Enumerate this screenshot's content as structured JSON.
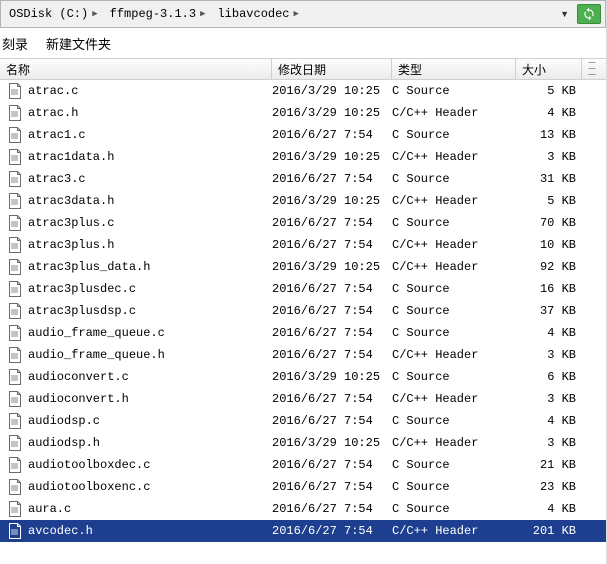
{
  "breadcrumb": {
    "root": "OSDisk (C:)",
    "p1": "ffmpeg-3.1.3",
    "p2": "libavcodec"
  },
  "toolbar": {
    "record": "刻录",
    "newfolder": "新建文件夹"
  },
  "columns": {
    "name": "名称",
    "date": "修改日期",
    "type": "类型",
    "size": "大小"
  },
  "files": [
    {
      "name": "atrac.c",
      "date": "2016/3/29 10:25",
      "type": "C Source",
      "size": "5 KB",
      "selected": false
    },
    {
      "name": "atrac.h",
      "date": "2016/3/29 10:25",
      "type": "C/C++ Header",
      "size": "4 KB",
      "selected": false
    },
    {
      "name": "atrac1.c",
      "date": "2016/6/27 7:54",
      "type": "C Source",
      "size": "13 KB",
      "selected": false
    },
    {
      "name": "atrac1data.h",
      "date": "2016/3/29 10:25",
      "type": "C/C++ Header",
      "size": "3 KB",
      "selected": false
    },
    {
      "name": "atrac3.c",
      "date": "2016/6/27 7:54",
      "type": "C Source",
      "size": "31 KB",
      "selected": false
    },
    {
      "name": "atrac3data.h",
      "date": "2016/3/29 10:25",
      "type": "C/C++ Header",
      "size": "5 KB",
      "selected": false
    },
    {
      "name": "atrac3plus.c",
      "date": "2016/6/27 7:54",
      "type": "C Source",
      "size": "70 KB",
      "selected": false
    },
    {
      "name": "atrac3plus.h",
      "date": "2016/6/27 7:54",
      "type": "C/C++ Header",
      "size": "10 KB",
      "selected": false
    },
    {
      "name": "atrac3plus_data.h",
      "date": "2016/3/29 10:25",
      "type": "C/C++ Header",
      "size": "92 KB",
      "selected": false
    },
    {
      "name": "atrac3plusdec.c",
      "date": "2016/6/27 7:54",
      "type": "C Source",
      "size": "16 KB",
      "selected": false
    },
    {
      "name": "atrac3plusdsp.c",
      "date": "2016/6/27 7:54",
      "type": "C Source",
      "size": "37 KB",
      "selected": false
    },
    {
      "name": "audio_frame_queue.c",
      "date": "2016/6/27 7:54",
      "type": "C Source",
      "size": "4 KB",
      "selected": false
    },
    {
      "name": "audio_frame_queue.h",
      "date": "2016/6/27 7:54",
      "type": "C/C++ Header",
      "size": "3 KB",
      "selected": false
    },
    {
      "name": "audioconvert.c",
      "date": "2016/3/29 10:25",
      "type": "C Source",
      "size": "6 KB",
      "selected": false
    },
    {
      "name": "audioconvert.h",
      "date": "2016/6/27 7:54",
      "type": "C/C++ Header",
      "size": "3 KB",
      "selected": false
    },
    {
      "name": "audiodsp.c",
      "date": "2016/6/27 7:54",
      "type": "C Source",
      "size": "4 KB",
      "selected": false
    },
    {
      "name": "audiodsp.h",
      "date": "2016/3/29 10:25",
      "type": "C/C++ Header",
      "size": "3 KB",
      "selected": false
    },
    {
      "name": "audiotoolboxdec.c",
      "date": "2016/6/27 7:54",
      "type": "C Source",
      "size": "21 KB",
      "selected": false
    },
    {
      "name": "audiotoolboxenc.c",
      "date": "2016/6/27 7:54",
      "type": "C Source",
      "size": "23 KB",
      "selected": false
    },
    {
      "name": "aura.c",
      "date": "2016/6/27 7:54",
      "type": "C Source",
      "size": "4 KB",
      "selected": false
    },
    {
      "name": "avcodec.h",
      "date": "2016/6/27 7:54",
      "type": "C/C++ Header",
      "size": "201 KB",
      "selected": true
    }
  ],
  "icons": {
    "file": "file-icon"
  }
}
